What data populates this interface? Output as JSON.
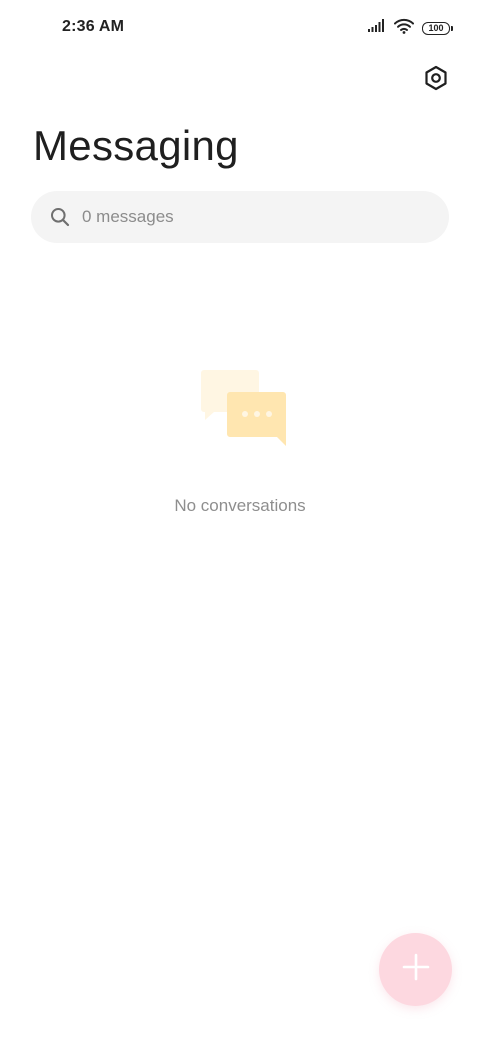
{
  "status_bar": {
    "time": "2:36 AM",
    "battery_level": "100",
    "icons": [
      "signal-icon",
      "wifi-icon",
      "battery-icon"
    ]
  },
  "header": {
    "title": "Messaging",
    "settings_icon": "settings-hexagon-icon"
  },
  "search": {
    "placeholder": "0 messages",
    "value": ""
  },
  "empty_state": {
    "illustration": "chat-bubbles-icon",
    "text": "No conversations"
  },
  "fab": {
    "icon": "plus-icon",
    "color": "#fdd8e0"
  },
  "colors": {
    "accent_light": "#fdd8e0",
    "illustration_yellow": "#ffe6b0",
    "illustration_yellow_light": "#fff6e3",
    "search_bg": "#f4f4f4"
  }
}
